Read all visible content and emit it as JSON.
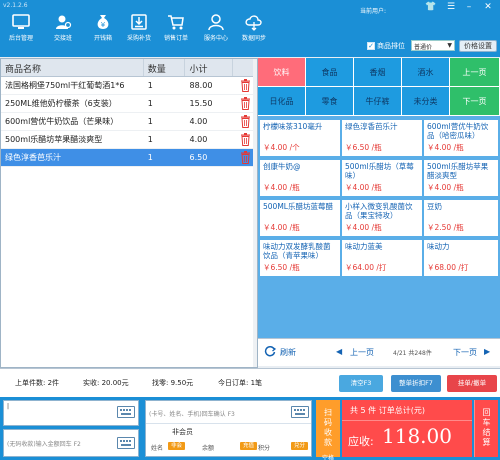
{
  "app": {
    "version": "v2.1.2.6",
    "current_user_label": "当前用户:"
  },
  "toolbar": {
    "items": [
      {
        "label": "后台管理",
        "icon": "monitor-icon"
      },
      {
        "label": "交接班",
        "icon": "user-search-icon"
      },
      {
        "label": "开钱箱",
        "icon": "money-bag-icon"
      },
      {
        "label": "采购补货",
        "icon": "download-box-icon"
      },
      {
        "label": "销售订单",
        "icon": "cart-icon"
      },
      {
        "label": "服务中心",
        "icon": "user-service-icon"
      },
      {
        "label": "数据同步",
        "icon": "cloud-sync-icon"
      }
    ],
    "product_sort_label": "商品排位",
    "product_sort_checked": true,
    "price_mode": "普通价",
    "price_settings_label": "价格设置"
  },
  "order": {
    "columns": [
      "商品名称",
      "数量",
      "小计",
      ""
    ],
    "rows": [
      {
        "name": "法国格桐堡750ml干红葡萄酒1*6",
        "qty": "1",
        "subtotal": "88.00"
      },
      {
        "name": "250ML维他奶柠檬茶（6支装）",
        "qty": "1",
        "subtotal": "15.50"
      },
      {
        "name": "600ml营优牛奶饮品（芒果味）",
        "qty": "1",
        "subtotal": "4.00"
      },
      {
        "name": "500ml乐醋坊苹果醋淡爽型",
        "qty": "1",
        "subtotal": "4.00"
      },
      {
        "name": "绿色淳香芭乐汁",
        "qty": "1",
        "subtotal": "6.50"
      }
    ]
  },
  "categories": {
    "row1": [
      "饮料",
      "食品",
      "香烟",
      "酒水",
      "上一页"
    ],
    "row2": [
      "日化品",
      "零食",
      "牛仔裤",
      "未分类",
      "下一页"
    ]
  },
  "products": [
    {
      "name": "柠檬味茶310毫升",
      "price": "￥4.00 /个"
    },
    {
      "name": "绿色淳香芭乐汁",
      "price": "￥6.50 /瓶"
    },
    {
      "name": "600ml营优牛奶饮品（哈密瓜味）",
      "price": "￥4.00 /瓶"
    },
    {
      "name": "创康牛奶@",
      "price": "￥4.00 /瓶"
    },
    {
      "name": "500ml乐醋坊（草莓味）",
      "price": "￥4.00 /瓶"
    },
    {
      "name": "500ml乐醋坊苹果醋淡爽型",
      "price": "￥4.00 /瓶"
    },
    {
      "name": "500ML乐醋坊蓝莓醋",
      "price": "￥4.00 /瓶"
    },
    {
      "name": "小样入微变乳酸菌饮品（果宝特攻）",
      "price": "￥4.00 /瓶"
    },
    {
      "name": "豆奶",
      "price": "￥2.50 /瓶"
    },
    {
      "name": "味动力双发酵乳酸菌饮品（青苹果味）",
      "price": "￥6.50 /瓶"
    },
    {
      "name": "味动力蓝美",
      "price": "￥64.00 /打"
    },
    {
      "name": "味动力",
      "price": "￥68.00 /打"
    }
  ],
  "pager": {
    "refresh_label": "刷新",
    "prev_label": "上一页",
    "page_info": "4/21 共248件",
    "next_label": "下一页"
  },
  "summary": {
    "last_qty": "上单件数:  2件",
    "paid": "实收:  20.00元",
    "change": "找零:  9.50元",
    "today_orders": "今日订单:  1笔",
    "btn_clear": "清空F3",
    "btn_hold": "整单折扣F7",
    "btn_pickup": "挂单/撤单"
  },
  "bottom": {
    "barcode_placeholder": "",
    "barcode_hint": "(无码收款)输入金额回车 F2",
    "member_search_placeholder": "(卡号、姓名、手机)回车确认 F3",
    "member_type": "非会员",
    "member_name_label": "姓名",
    "member_level_badge": "非会",
    "balance_label": "余额",
    "balance_badge": "充值",
    "points_label": "积分",
    "points_badge": "兑分",
    "checkout_label": "扫码收款",
    "checkout_key": "空格",
    "total_text": "共 5 件  订单总计(元)",
    "due_label": "应收:",
    "due_amount": "118.00",
    "settle_label": "回车结算"
  }
}
